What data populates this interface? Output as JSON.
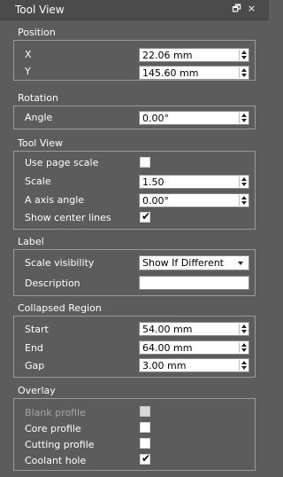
{
  "window": {
    "title": "Tool View",
    "restore_icon": "restore-window-icon",
    "close_icon": "close-icon"
  },
  "position": {
    "header": "Position",
    "x_label": "X",
    "x_value": "22.06 mm",
    "y_label": "Y",
    "y_value": "145.60 mm"
  },
  "rotation": {
    "header": "Rotation",
    "angle_label": "Angle",
    "angle_value": "0.00°"
  },
  "tool_view": {
    "header": "Tool View",
    "use_page_scale_label": "Use page scale",
    "use_page_scale_checked": false,
    "scale_label": "Scale",
    "scale_value": "1.50",
    "a_axis_label": "A axis angle",
    "a_axis_value": "0.00°",
    "center_lines_label": "Show center lines",
    "center_lines_checked": true
  },
  "label": {
    "header": "Label",
    "scale_visibility_label": "Scale visibility",
    "scale_visibility_value": "Show If Different",
    "description_label": "Description",
    "description_value": ""
  },
  "collapsed_region": {
    "header": "Collapsed Region",
    "start_label": "Start",
    "start_value": "54.00 mm",
    "end_label": "End",
    "end_value": "64.00 mm",
    "gap_label": "Gap",
    "gap_value": "3.00 mm"
  },
  "overlay": {
    "header": "Overlay",
    "blank_profile_label": "Blank profile",
    "blank_profile_checked": false,
    "blank_profile_enabled": false,
    "core_profile_label": "Core profile",
    "core_profile_checked": false,
    "cutting_profile_label": "Cutting profile",
    "cutting_profile_checked": false,
    "coolant_hole_label": "Coolant hole",
    "coolant_hole_checked": true
  },
  "check_glyph": "✔"
}
